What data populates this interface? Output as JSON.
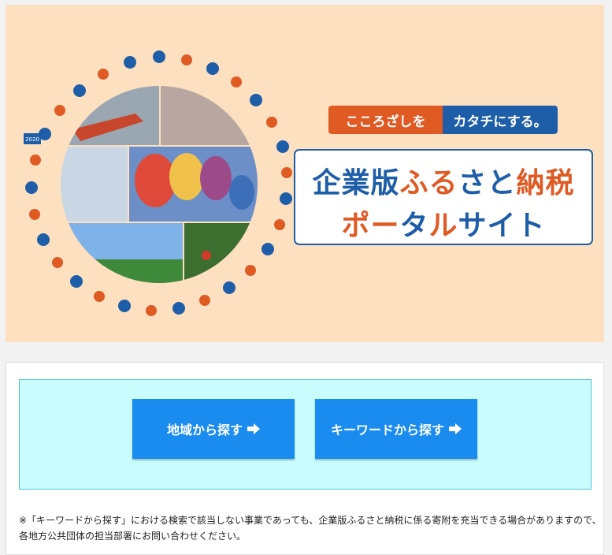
{
  "hero": {
    "tagline_left": "こころざしを",
    "tagline_right": "カタチにする。",
    "title_line1": [
      "企業版",
      "ふる",
      "さと",
      "納税"
    ],
    "title_line2": [
      "ポー",
      "タ",
      "ル",
      "サイト"
    ],
    "icon_year_label": "2020"
  },
  "search": {
    "region_button": "地域から探す",
    "keyword_button": "キーワードから探す"
  },
  "note": "※「キーワードから探す」における検索で該当しない事業であっても、企業版ふるさと納税に係る寄附を充当できる場合がありますので、各地方公共団体の担当部署にお問い合わせください。",
  "colors": {
    "brand_blue": "#1e5da8",
    "brand_orange": "#e05a24",
    "button_blue": "#1a8cf0",
    "search_bg": "#c9fdfd"
  }
}
